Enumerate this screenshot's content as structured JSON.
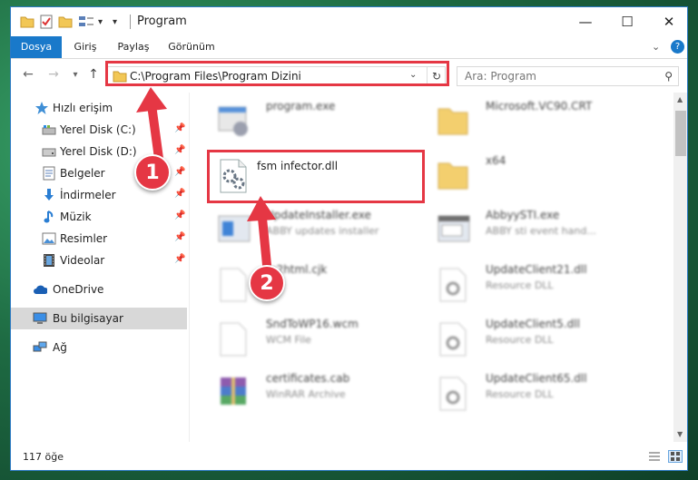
{
  "window": {
    "title": "Program"
  },
  "ribbon": {
    "tabs": [
      "Dosya",
      "Giriş",
      "Paylaş",
      "Görünüm"
    ]
  },
  "address": {
    "path": "C:\\Program Files\\Program Dizini"
  },
  "search": {
    "placeholder": "Ara: Program"
  },
  "nav": {
    "items": [
      {
        "label": "Hızlı erişim",
        "icon": "star-icon"
      },
      {
        "label": "Yerel Disk (C:)",
        "icon": "drive-icon",
        "pinned": true
      },
      {
        "label": "Yerel Disk (D:)",
        "icon": "drive-icon",
        "pinned": true
      },
      {
        "label": "Belgeler",
        "icon": "documents-icon",
        "pinned": true
      },
      {
        "label": "İndirmeler",
        "icon": "download-icon",
        "pinned": true
      },
      {
        "label": "Müzik",
        "icon": "music-icon",
        "pinned": true
      },
      {
        "label": "Resimler",
        "icon": "pictures-icon",
        "pinned": true
      },
      {
        "label": "Videolar",
        "icon": "video-icon",
        "pinned": true
      },
      {
        "label": "OneDrive",
        "icon": "cloud-icon"
      },
      {
        "label": "Bu bilgisayar",
        "icon": "computer-icon",
        "selected": true
      },
      {
        "label": "Ağ",
        "icon": "network-icon"
      }
    ]
  },
  "files": {
    "left": [
      {
        "name": "program.exe",
        "desc": ""
      },
      {
        "name": "fsm infector.dll",
        "desc": ""
      },
      {
        "name": "UpdateInstaller.exe",
        "desc": "ABBY updates installer"
      },
      {
        "name": "fo2html.cjk",
        "desc": ""
      },
      {
        "name": "SndToWP16.wcm",
        "desc": "WCM File"
      },
      {
        "name": "certificates.cab",
        "desc": "WinRAR Archive"
      }
    ],
    "right": [
      {
        "name": "Microsoft.VC90.CRT",
        "desc": ""
      },
      {
        "name": "x64",
        "desc": ""
      },
      {
        "name": "AbbyySTI.exe",
        "desc": "ABBY sti event hand..."
      },
      {
        "name": "UpdateClient21.dll",
        "desc": "Resource DLL"
      },
      {
        "name": "UpdateClient5.dll",
        "desc": "Resource DLL"
      },
      {
        "name": "UpdateClient65.dll",
        "desc": "Resource DLL"
      }
    ]
  },
  "status": {
    "count": "117 öğe"
  },
  "markers": [
    "1",
    "2"
  ],
  "colors": {
    "accent": "#1979ca",
    "highlight": "#e53744",
    "folder": "#f2c755"
  }
}
